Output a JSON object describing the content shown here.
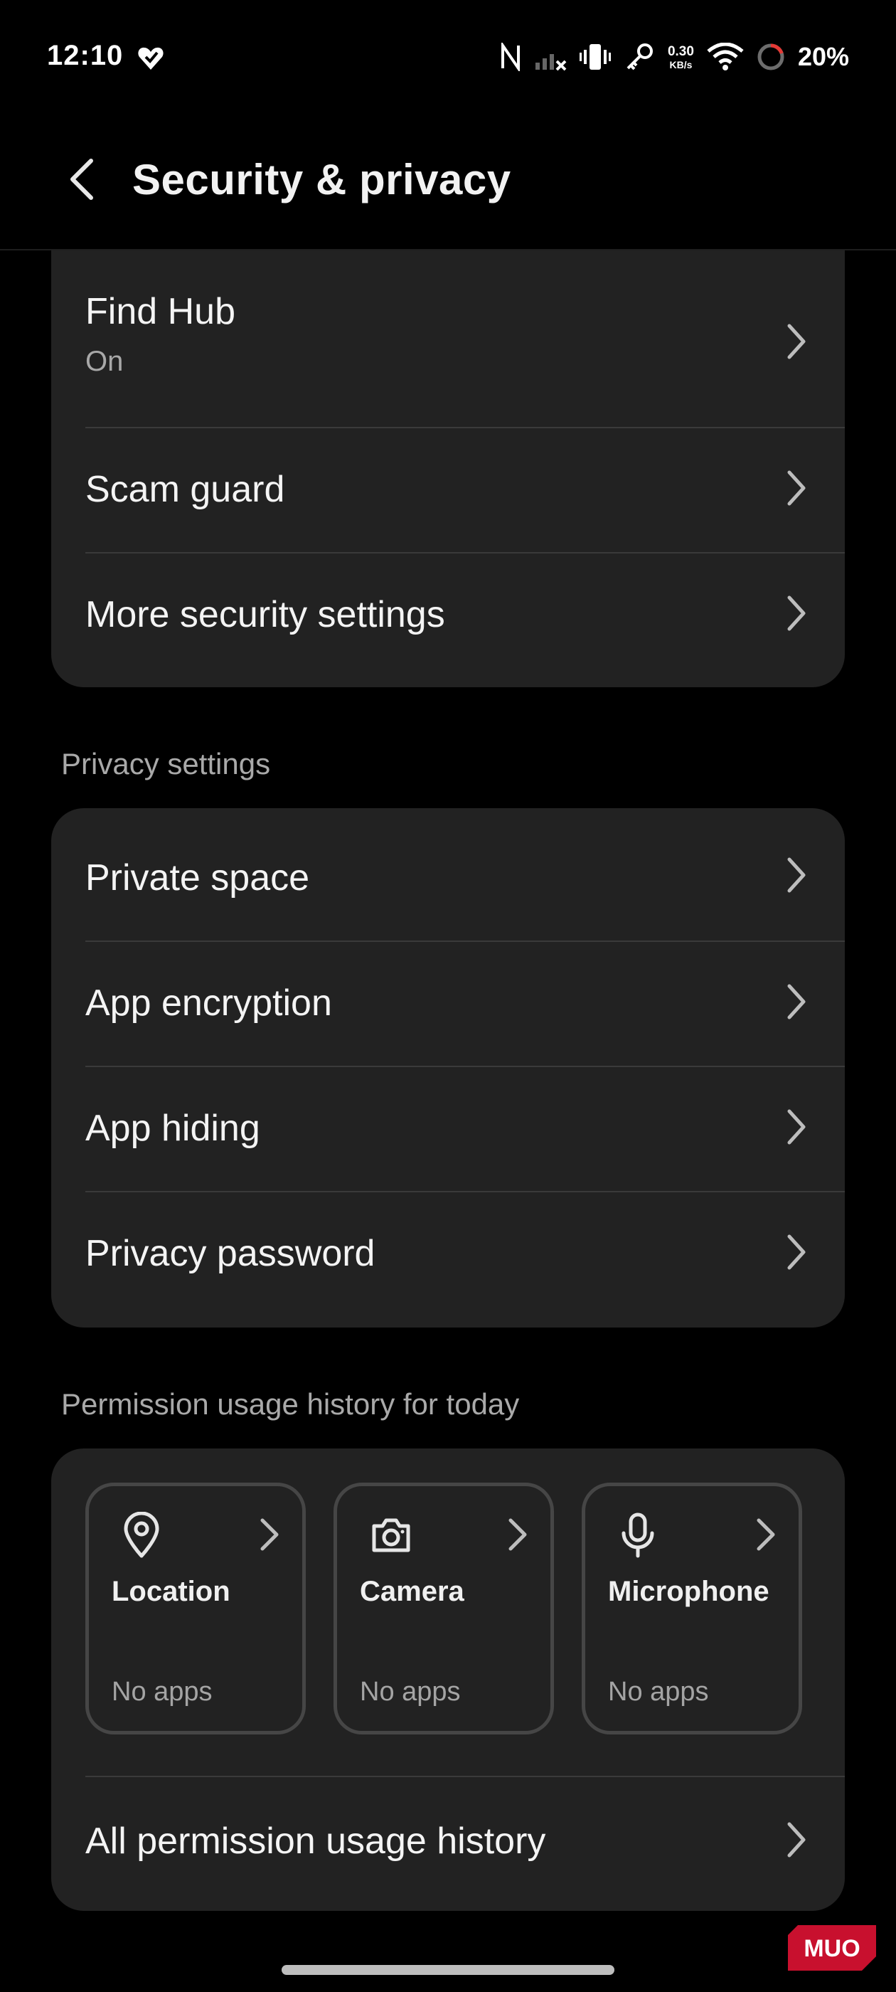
{
  "status_bar": {
    "time": "12:10",
    "net_speed_value": "0.30",
    "net_speed_unit": "KB/s",
    "battery_percent": "20%"
  },
  "app_bar": {
    "title": "Security & privacy"
  },
  "security_card": {
    "items": [
      {
        "label": "Find Hub",
        "sub": "On"
      },
      {
        "label": "Scam guard"
      },
      {
        "label": "More security settings"
      }
    ]
  },
  "privacy_settings": {
    "header": "Privacy settings",
    "items": [
      {
        "label": "Private space"
      },
      {
        "label": "App encryption"
      },
      {
        "label": "App hiding"
      },
      {
        "label": "Privacy password"
      }
    ]
  },
  "permission_history": {
    "header": "Permission usage history for today",
    "tiles": [
      {
        "label": "Location",
        "value": "No apps",
        "icon": "location-pin-icon"
      },
      {
        "label": "Camera",
        "value": "No apps",
        "icon": "camera-icon"
      },
      {
        "label": "Microphone",
        "value": "No apps",
        "icon": "microphone-icon"
      }
    ],
    "all_history_label": "All permission usage history"
  },
  "watermark": {
    "text": "MUO",
    "color": "#c8102e"
  }
}
